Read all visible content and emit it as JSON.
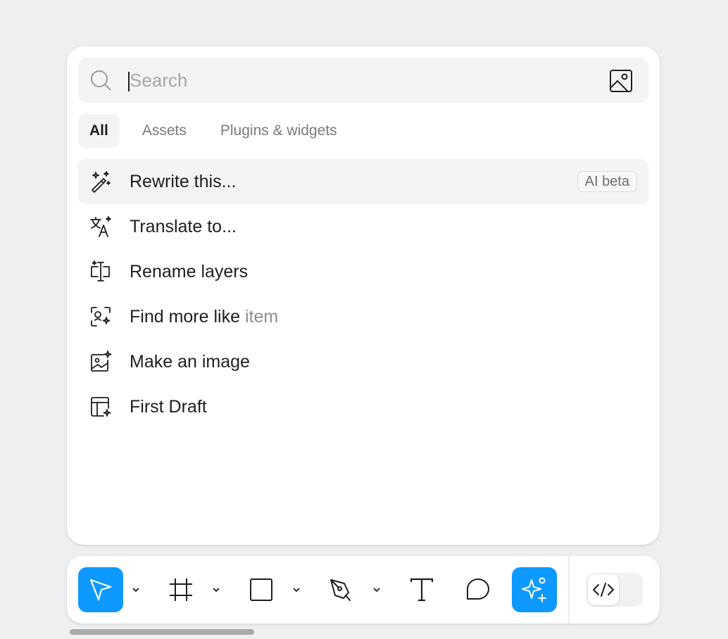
{
  "search": {
    "placeholder": "Search"
  },
  "tabs": [
    {
      "label": "All",
      "active": true
    },
    {
      "label": "Assets",
      "active": false
    },
    {
      "label": "Plugins & widgets",
      "active": false
    }
  ],
  "actions": [
    {
      "label": "Rewrite this...",
      "icon": "magic-wand-icon",
      "badge": "AI beta"
    },
    {
      "label": "Translate to...",
      "icon": "translate-icon"
    },
    {
      "label": "Rename layers",
      "icon": "rename-layers-icon"
    },
    {
      "label": "Find more like",
      "suffix": "item",
      "icon": "find-similar-icon"
    },
    {
      "label": "Make an image",
      "icon": "make-image-icon"
    },
    {
      "label": "First Draft",
      "icon": "first-draft-icon"
    }
  ],
  "toolbar": {
    "tools": [
      {
        "name": "move-tool",
        "icon": "cursor-icon",
        "active": true
      },
      {
        "name": "frame-tool",
        "icon": "frame-icon"
      },
      {
        "name": "shape-tool",
        "icon": "rectangle-icon"
      },
      {
        "name": "pen-tool",
        "icon": "pen-icon"
      },
      {
        "name": "text-tool",
        "icon": "text-icon"
      },
      {
        "name": "comment-tool",
        "icon": "comment-icon"
      },
      {
        "name": "ai-tool",
        "icon": "sparkle-icon",
        "active": true
      }
    ],
    "dev_mode_icon": "code-icon"
  },
  "colors": {
    "accent": "#0d99ff",
    "background": "#eeeff1",
    "muted_text": "#8c8c8c"
  }
}
